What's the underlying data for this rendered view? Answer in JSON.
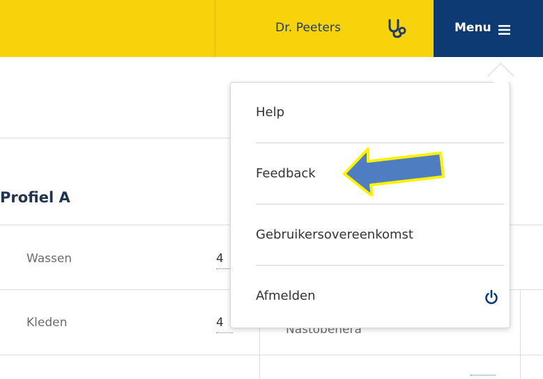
{
  "header": {
    "user_name": "Dr. Peeters",
    "user_icon": "stethoscope-icon",
    "menu_label": "Menu",
    "menu_icon": "hamburger-icon",
    "bar_color": "#f8d30c",
    "menu_color": "#0e3a73"
  },
  "dropdown": {
    "items": [
      {
        "label": "Help"
      },
      {
        "label": "Feedback"
      },
      {
        "label": "Gebruikersovereenkomst"
      },
      {
        "label": "Afmelden",
        "icon": "power-icon"
      }
    ],
    "annotation": {
      "type": "arrow",
      "target": "Feedback",
      "fill_color": "#4f7dc2",
      "outline_color": "#fff200"
    }
  },
  "profile": {
    "title": "Profiel A",
    "rows": [
      {
        "label": "Wassen",
        "value": "4"
      },
      {
        "label": "Kleden",
        "value": "4"
      }
    ],
    "partial_text": "Nastobenera"
  }
}
